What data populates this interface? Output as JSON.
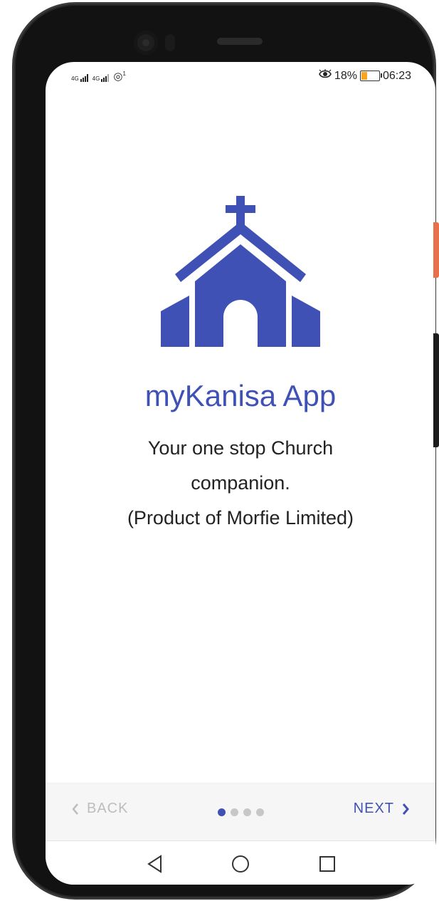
{
  "status_bar": {
    "network_1": "4G",
    "network_2": "4G",
    "hotspot_sup": "1",
    "battery_percent": "18%",
    "time": "06:23",
    "icons": [
      "signal-icon",
      "signal-icon",
      "hotspot-icon",
      "eye-comfort-icon",
      "battery-icon"
    ]
  },
  "onboarding": {
    "logo_icon": "church-icon",
    "title": "myKanisa App",
    "tagline_lines": [
      "Your one stop Church",
      "companion.",
      "(Product of Morfie Limited)"
    ],
    "accent_color": "#3f51b5"
  },
  "bottom_nav": {
    "back_label": "BACK",
    "next_label": "NEXT",
    "page_indicator": {
      "total": 4,
      "current": 1
    }
  },
  "system_nav": {
    "icons": [
      "back-triangle-icon",
      "home-circle-icon",
      "recents-square-icon"
    ]
  }
}
